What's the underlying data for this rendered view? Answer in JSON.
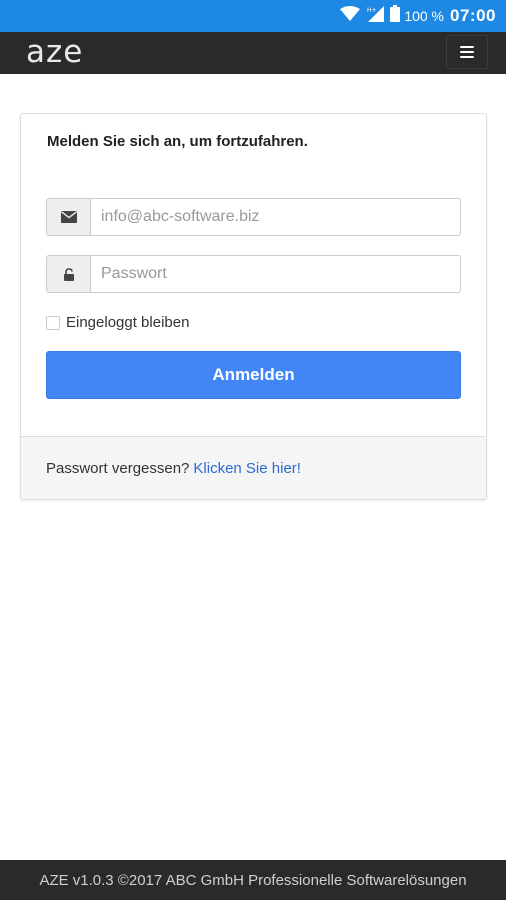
{
  "status_bar": {
    "battery_text": "100 %",
    "clock": "07:00",
    "icons": [
      "wifi-icon",
      "signal-icon",
      "battery-icon"
    ]
  },
  "navbar": {
    "brand": "aze",
    "menu_icon": "hamburger-icon"
  },
  "login": {
    "heading": "Melden Sie sich an, um fortzufahren.",
    "email": {
      "icon": "envelope-icon",
      "placeholder": "info@abc-software.biz",
      "value": ""
    },
    "password": {
      "icon": "lock-icon",
      "placeholder": "Passwort",
      "value": ""
    },
    "remember_label": "Eingeloggt bleiben",
    "remember_checked": false,
    "submit_label": "Anmelden",
    "forgot_text": "Passwort vergessen?",
    "forgot_link": "Klicken Sie hier!"
  },
  "footer": {
    "text": "AZE v1.0.3 ©2017 ABC GmbH Professionelle Softwarelösungen"
  },
  "colors": {
    "status_bar": "#1e88e5",
    "navbar": "#2a2a2a",
    "primary_button": "#4285f4",
    "link": "#2a6bd6"
  }
}
